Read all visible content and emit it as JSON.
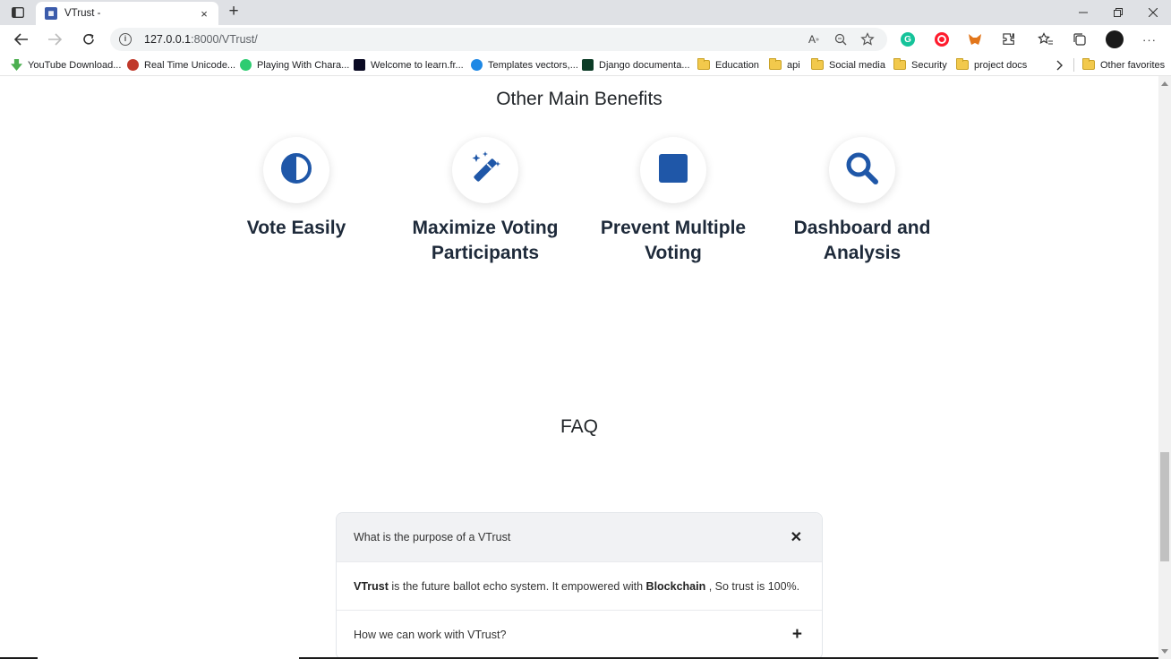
{
  "browser": {
    "tab_title": "VTrust -",
    "tab_close": "×",
    "new_tab": "+",
    "url_host": "127.0.0.1",
    "url_path": ":8000/VTrust/",
    "more": "···"
  },
  "bookmarks": [
    {
      "label": "YouTube Download...",
      "color": "#4caf50"
    },
    {
      "label": "Real Time Unicode...",
      "color": "#c0392b"
    },
    {
      "label": "Playing With Chara...",
      "color": "#2ecc71"
    },
    {
      "label": "Welcome to learn.fr...",
      "color": "#0a0a23"
    },
    {
      "label": "Templates vectors,...",
      "color": "#1e88e5"
    },
    {
      "label": "Django documenta...",
      "color": "#0c3c26"
    },
    {
      "label": "Education",
      "folder": true
    },
    {
      "label": "api",
      "folder": true
    },
    {
      "label": "Social media",
      "folder": true
    },
    {
      "label": "Security",
      "folder": true
    },
    {
      "label": "project docs",
      "folder": true
    }
  ],
  "other_favorites": "Other favorites",
  "benefits": {
    "title": "Other Main Benefits",
    "items": [
      {
        "line1": "Vote Easily",
        "line2": "",
        "icon": "half-circle-icon"
      },
      {
        "line1": "Maximize Voting",
        "line2": "Participants",
        "icon": "magic-wand-icon"
      },
      {
        "line1": "Prevent Multiple",
        "line2": "Voting",
        "icon": "square-icon"
      },
      {
        "line1": "Dashboard and",
        "line2": "Analysis",
        "icon": "search-icon"
      }
    ]
  },
  "faq": {
    "title": "FAQ",
    "items": [
      {
        "question": "What is the purpose of a VTrust",
        "toggle": "✕",
        "open": true,
        "answer_parts": [
          "VTrust",
          " is the future ballot echo system. It empowered with ",
          "Blockchain",
          " , So trust is 100%."
        ]
      },
      {
        "question": "How we can work with VTrust?",
        "toggle": "+",
        "open": false
      }
    ]
  },
  "colors": {
    "accent": "#1f57a8",
    "heading": "#1e2a3a"
  }
}
